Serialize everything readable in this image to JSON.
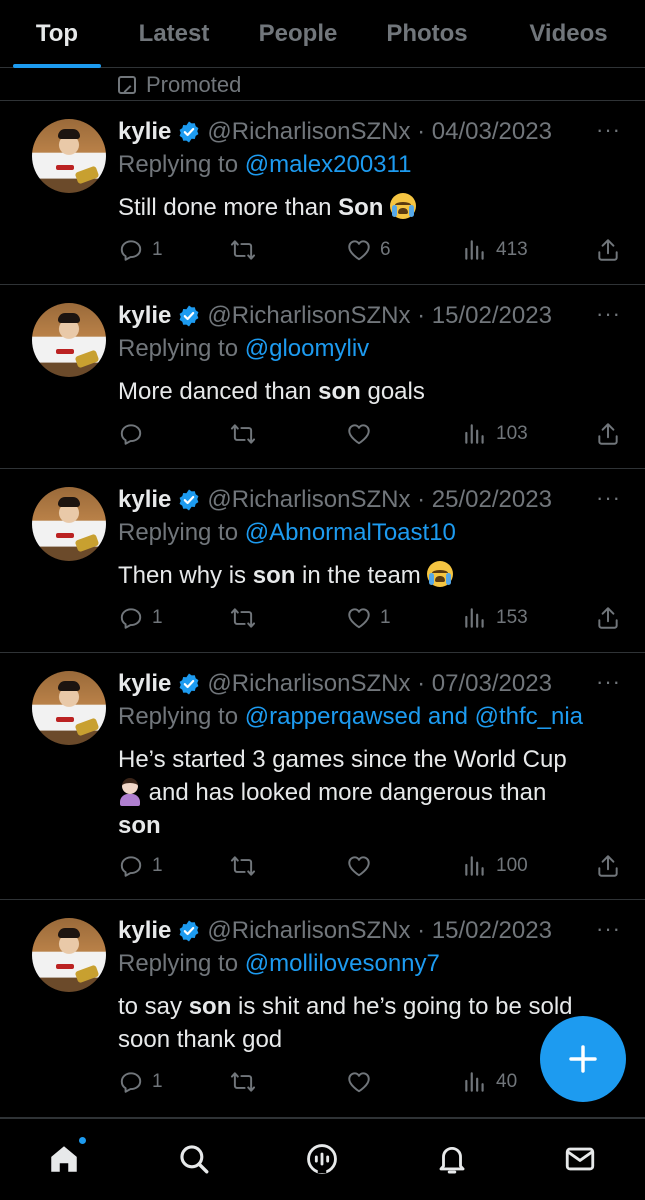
{
  "tabs": [
    {
      "label": "Top",
      "active": true
    },
    {
      "label": "Latest",
      "active": false
    },
    {
      "label": "People",
      "active": false
    },
    {
      "label": "Photos",
      "active": false
    },
    {
      "label": "Videos",
      "active": false
    }
  ],
  "promoted_label": "Promoted",
  "tweets": [
    {
      "name": "kylie",
      "handle_date": "@RicharlisonSZNx · 04/03/2023",
      "replying_prefix": "Replying to ",
      "replying_to": "@malex200311",
      "replying_to_2": "",
      "replying_joiner": "",
      "text_parts": [
        "Still done more than ",
        "Son",
        " "
      ],
      "emoji": "crying-face",
      "replies": "1",
      "retweets": "",
      "likes": "6",
      "views": "413"
    },
    {
      "name": "kylie",
      "handle_date": "@RicharlisonSZNx · 15/02/2023",
      "replying_prefix": "Replying to ",
      "replying_to": "@gloomyliv",
      "replying_to_2": "",
      "replying_joiner": "",
      "text_parts": [
        "More danced than ",
        "son",
        " goals"
      ],
      "emoji": "",
      "replies": "",
      "retweets": "",
      "likes": "",
      "views": "103"
    },
    {
      "name": "kylie",
      "handle_date": "@RicharlisonSZNx · 25/02/2023",
      "replying_prefix": "Replying to ",
      "replying_to": "@AbnormalToast10",
      "replying_to_2": "",
      "replying_joiner": "",
      "text_parts": [
        "Then why is ",
        "son",
        " in the team "
      ],
      "emoji": "crying-face",
      "replies": "1",
      "retweets": "",
      "likes": "1",
      "views": "153"
    },
    {
      "name": "kylie",
      "handle_date": "@RicharlisonSZNx · 07/03/2023",
      "replying_prefix": "Replying to ",
      "replying_to": "@rapperqawsed",
      "replying_joiner": " and ",
      "replying_to_2": "@thfc_nia",
      "text_line1": "He’s started 3 games since the World Cup",
      "text_line2": " and has looked more dangerous than",
      "text_bold": "son",
      "emoji": "person-facepalming",
      "replies": "1",
      "retweets": "",
      "likes": "",
      "views": "100"
    },
    {
      "name": "kylie",
      "handle_date": "@RicharlisonSZNx · 15/02/2023",
      "replying_prefix": "Replying to ",
      "replying_to": "@mollilovesonny7",
      "replying_to_2": "",
      "replying_joiner": "",
      "text_parts": [
        "to say ",
        "son",
        " is shit and he’s going to be sold soon thank god"
      ],
      "emoji": "",
      "replies": "1",
      "retweets": "",
      "likes": "",
      "views": "40"
    }
  ],
  "more_label": "···",
  "colors": {
    "accent": "#1d9bf0",
    "muted": "#71767b",
    "text": "#e7e9ea",
    "divider": "#2f3336",
    "background": "#000000"
  },
  "icons": [
    "reply-icon",
    "retweet-icon",
    "like-icon",
    "views-icon",
    "share-icon",
    "verified-badge-icon",
    "compose-icon",
    "home-icon",
    "search-icon",
    "spaces-icon",
    "notifications-icon",
    "messages-icon"
  ]
}
